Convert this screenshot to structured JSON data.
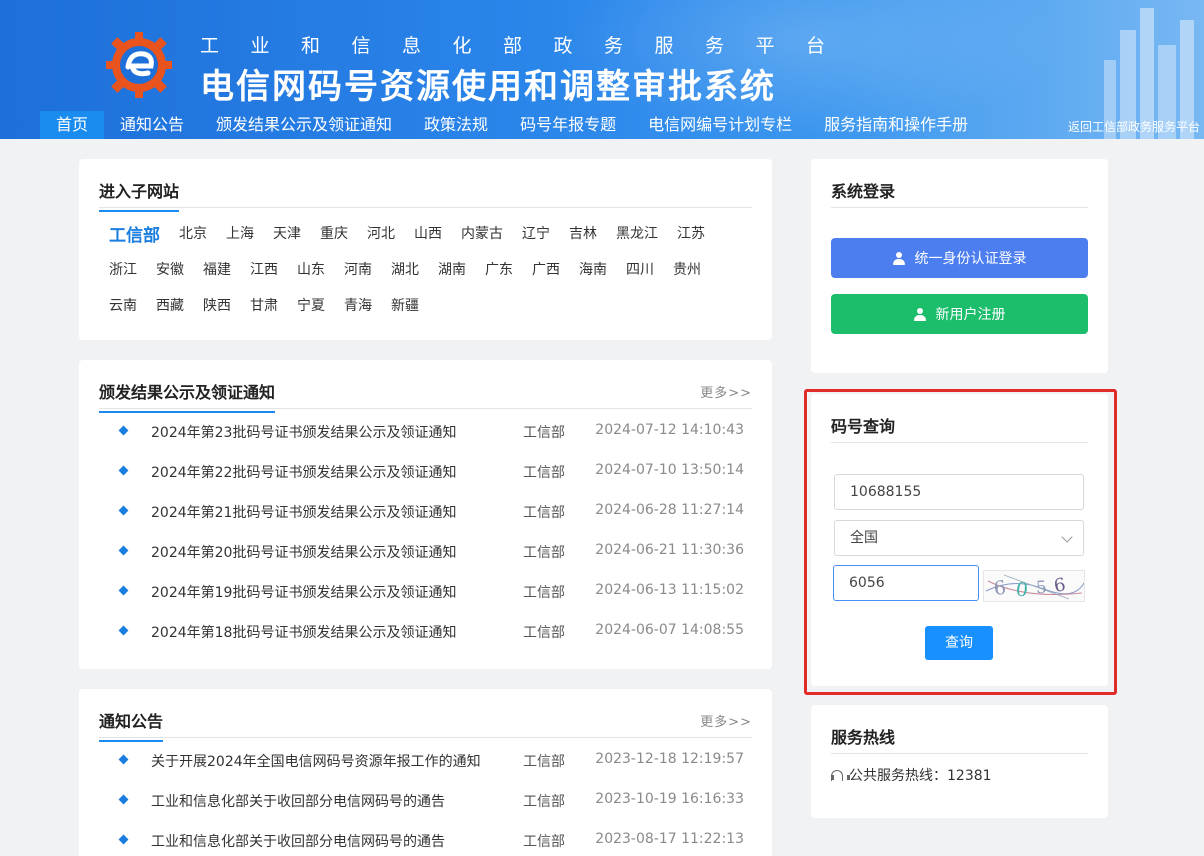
{
  "header": {
    "subtitle": "工业和信息化部政务服务平台",
    "title": "电信网码号资源使用和调整审批系统",
    "back_link": "返回工信部政务服务平台",
    "nav": [
      {
        "label": "首页",
        "active": true
      },
      {
        "label": "通知公告"
      },
      {
        "label": "颁发结果公示及领证通知"
      },
      {
        "label": "政策法规"
      },
      {
        "label": "码号年报专题"
      },
      {
        "label": "电信网编号计划专栏"
      },
      {
        "label": "服务指南和操作手册"
      }
    ]
  },
  "subsites": {
    "title": "进入子网站",
    "rows": [
      [
        "工信部",
        "北京",
        "上海",
        "天津",
        "重庆",
        "河北",
        "山西",
        "内蒙古",
        "辽宁",
        "吉林",
        "黑龙江",
        "江苏"
      ],
      [
        "浙江",
        "安徽",
        "福建",
        "江西",
        "山东",
        "河南",
        "湖北",
        "湖南",
        "广东",
        "广西",
        "海南",
        "四川",
        "贵州"
      ],
      [
        "云南",
        "西藏",
        "陕西",
        "甘肃",
        "宁夏",
        "青海",
        "新疆"
      ]
    ]
  },
  "results": {
    "title": "颁发结果公示及领证通知",
    "more": "更多>>",
    "items": [
      {
        "title": "2024年第23批码号证书颁发结果公示及领证通知",
        "dept": "工信部",
        "date": "2024-07-12 14:10:43"
      },
      {
        "title": "2024年第22批码号证书颁发结果公示及领证通知",
        "dept": "工信部",
        "date": "2024-07-10 13:50:14"
      },
      {
        "title": "2024年第21批码号证书颁发结果公示及领证通知",
        "dept": "工信部",
        "date": "2024-06-28 11:27:14"
      },
      {
        "title": "2024年第20批码号证书颁发结果公示及领证通知",
        "dept": "工信部",
        "date": "2024-06-21 11:30:36"
      },
      {
        "title": "2024年第19批码号证书颁发结果公示及领证通知",
        "dept": "工信部",
        "date": "2024-06-13 11:15:02"
      },
      {
        "title": "2024年第18批码号证书颁发结果公示及领证通知",
        "dept": "工信部",
        "date": "2024-06-07 14:08:55"
      }
    ]
  },
  "notices": {
    "title": "通知公告",
    "more": "更多>>",
    "items": [
      {
        "title": "关于开展2024年全国电信网码号资源年报工作的通知",
        "dept": "工信部",
        "date": "2023-12-18 12:19:57"
      },
      {
        "title": "工业和信息化部关于收回部分电信网码号的通告",
        "dept": "工信部",
        "date": "2023-10-19 16:16:33"
      },
      {
        "title": "工业和信息化部关于收回部分电信网码号的通告",
        "dept": "工信部",
        "date": "2023-08-17 11:22:13"
      }
    ]
  },
  "login": {
    "title": "系统登录",
    "unified_login": "统一身份认证登录",
    "register": "新用户注册"
  },
  "query": {
    "title": "码号查询",
    "number_value": "10688155",
    "region_value": "全国",
    "captcha_input": "6056",
    "captcha_text": "6056",
    "submit": "查询"
  },
  "hotline": {
    "title": "服务热线",
    "text": "公共服务热线：12381"
  },
  "colors": {
    "accent": "#1a8cf0",
    "login_button": "#4d7ef0",
    "register_button": "#1cbe6c",
    "highlight_frame": "#e02b2b"
  }
}
